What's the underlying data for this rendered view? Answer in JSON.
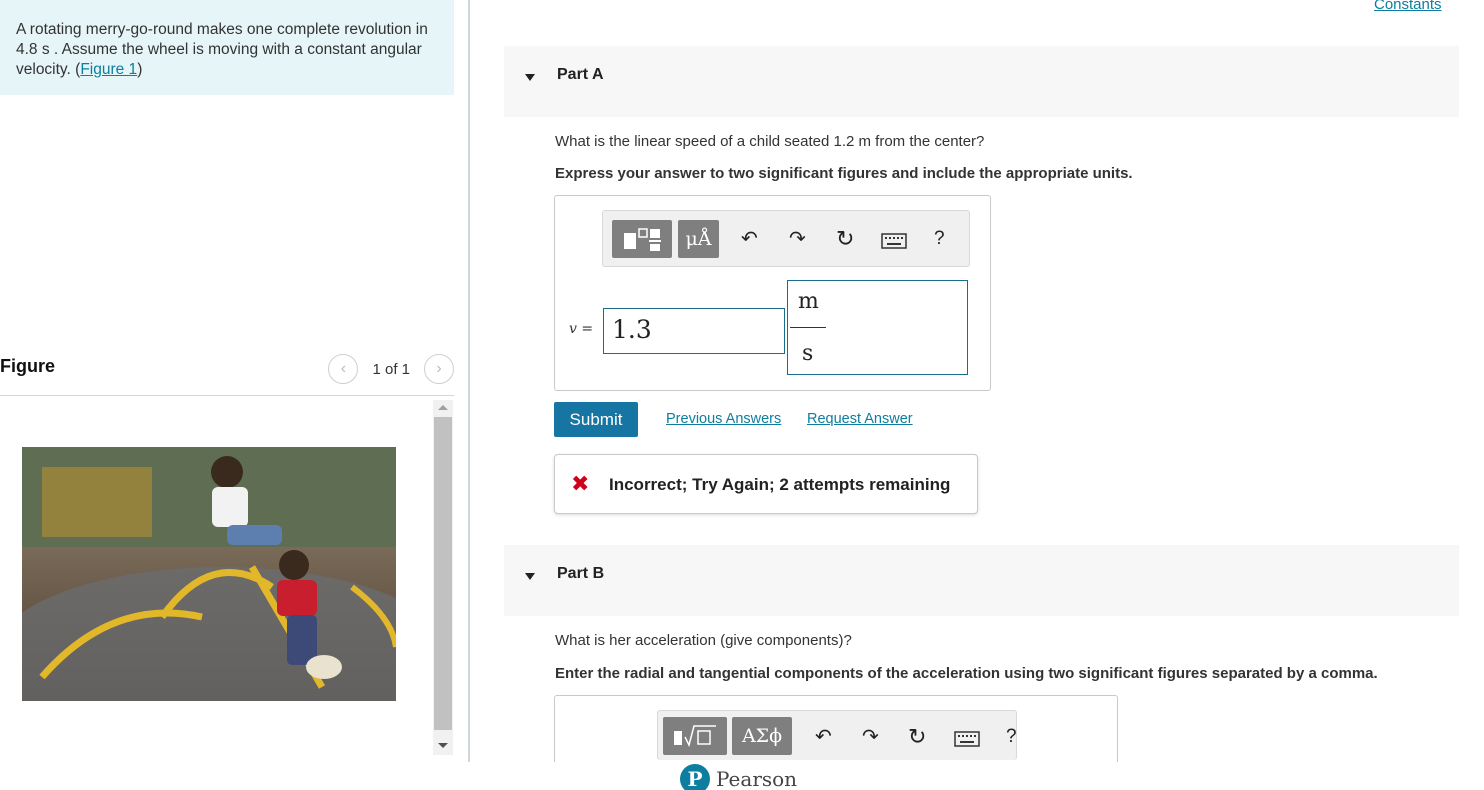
{
  "intro": {
    "text": "A rotating merry-go-round makes one complete revolution in 4.8 s . Assume the wheel is moving with a constant angular velocity. (",
    "link": "Figure 1",
    "suffix": ")"
  },
  "figure": {
    "title": "Figure",
    "pager": "1 of 1",
    "prev_icon": "chevron-left-icon",
    "next_icon": "chevron-right-icon"
  },
  "constants_link": "Constants",
  "part_a": {
    "label": "Part A",
    "question": "What is the linear speed of a child seated 1.2 m from the center?",
    "instruction": "Express your answer to two significant figures and include the appropriate units.",
    "toolbar": {
      "template_label": "▫▫",
      "units_label": "μÅ",
      "icons": [
        "undo-icon",
        "redo-icon",
        "reset-icon",
        "keyboard-icon",
        "help-icon"
      ],
      "help_label": "?"
    },
    "variable": "v =",
    "value": "1.3",
    "units_numerator": "m",
    "units_denominator": "s",
    "submit_label": "Submit",
    "previous_answers": "Previous Answers",
    "request_answer": "Request Answer",
    "feedback": "Incorrect; Try Again; 2 attempts remaining",
    "feedback_color": "#d0021b"
  },
  "part_b": {
    "label": "Part B",
    "question": "What is her acceleration (give components)?",
    "instruction": "Enter the radial and tangential components of the acceleration using two significant figures separated by a comma.",
    "toolbar": {
      "template_label": "▮√▯",
      "greek_label": "ΑΣϕ",
      "help_label": "?"
    }
  },
  "footer": {
    "brand": "Pearson"
  },
  "colors": {
    "accent": "#0d7ea0",
    "submit": "#1675a3",
    "intro_bg": "#e6f5f7"
  }
}
